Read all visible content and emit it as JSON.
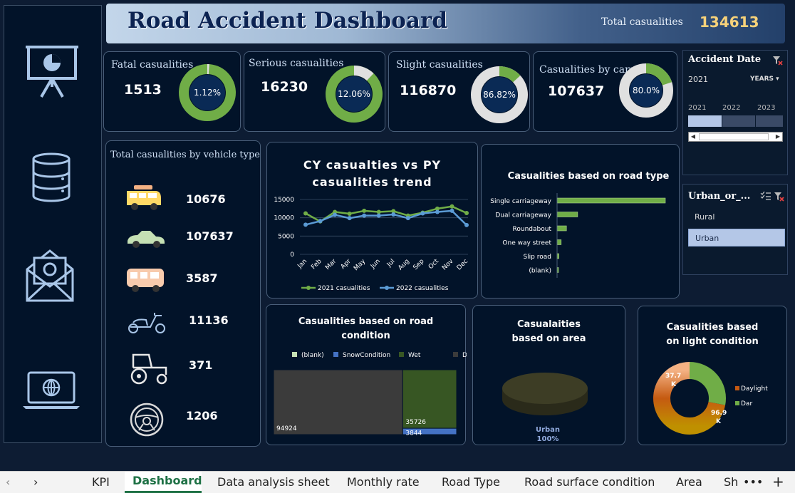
{
  "header": {
    "title": "Road Accident Dashboard",
    "total_label": "Total casualities",
    "total_value": "134613"
  },
  "kpis": [
    {
      "label": "Fatal casualities",
      "value": "1513",
      "pct": "1.12%",
      "fraction": 0.0112
    },
    {
      "label": "Serious casualities",
      "value": "16230",
      "pct": "12.06%",
      "fraction": 0.1206
    },
    {
      "label": "Slight casualities",
      "value": "116870",
      "pct": "86.82%",
      "fraction": 0.8682
    },
    {
      "label": "Casualities by cars",
      "value": "107637",
      "pct": "80.0%",
      "fraction": 0.8
    }
  ],
  "vehicle": {
    "title": "Total casualities by vehicle type",
    "items": [
      {
        "icon": "van-icon",
        "value": "10676"
      },
      {
        "icon": "car-icon",
        "value": "107637"
      },
      {
        "icon": "bus-icon",
        "value": "3587"
      },
      {
        "icon": "scooter-icon",
        "value": "11136"
      },
      {
        "icon": "tractor-icon",
        "value": "371"
      },
      {
        "icon": "steering-wheel-icon",
        "value": "1206"
      }
    ]
  },
  "colors": {
    "green": "#70ad47",
    "blue": "#5b9bd5",
    "gold": "#f7d27a"
  },
  "chart_data": [
    {
      "type": "line",
      "title": "CY casualties vs PY casualities trend",
      "categories": [
        "Jan",
        "Feb",
        "Mar",
        "Apr",
        "May",
        "Jun",
        "Jul",
        "Aug",
        "Sep",
        "Oct",
        "Nov",
        "Dec"
      ],
      "series": [
        {
          "name": "2021 casualities",
          "values": [
            11200,
            9000,
            11600,
            11100,
            11900,
            11600,
            11800,
            10600,
            11400,
            12500,
            13100,
            11300
          ]
        },
        {
          "name": "2022 casualities",
          "values": [
            8100,
            9100,
            10800,
            9900,
            10600,
            10600,
            10900,
            9900,
            11200,
            11600,
            11900,
            8000
          ]
        }
      ],
      "ylim": [
        0,
        15000
      ],
      "yticks": [
        "15000",
        "10000",
        "5000",
        "0"
      ],
      "grid": true,
      "legend": "bottom"
    },
    {
      "type": "bar",
      "title": "Casualities based on road type",
      "categories": [
        "Single carriageway",
        "Dual carriageway",
        "Roundabout",
        "One way street",
        "Slip road",
        "(blank)"
      ],
      "values": [
        100000,
        19000,
        8700,
        3800,
        1700,
        1200
      ]
    },
    {
      "type": "treemap",
      "title": "Casualities based on road condition",
      "legend": [
        "(blank)",
        "SnowCondition",
        "Wet",
        "Dry"
      ],
      "legend_colors": [
        "#c5e0b4",
        "#4472c4",
        "#375623",
        "#3b3b3b"
      ],
      "values": [
        {
          "name": "Dry",
          "value": 94924
        },
        {
          "name": "Wet",
          "value": 35726
        },
        {
          "name": "SnowCondition",
          "value": 3844
        }
      ],
      "labels": [
        "94924",
        "35726",
        "3844"
      ]
    },
    {
      "type": "pie",
      "title": "Casualaities based on area",
      "labels": [
        "Urban"
      ],
      "values": [
        100
      ],
      "data_label": "100%"
    },
    {
      "type": "pie",
      "title": "Casualities based on light condition",
      "labels": [
        "Daylight",
        "Dar"
      ],
      "values": [
        96.9,
        37.7
      ],
      "data_labels": [
        "96.9 K",
        "37.7 K"
      ]
    }
  ],
  "date_slicer": {
    "title": "Accident Date",
    "selected": "2021",
    "level": "YEARS",
    "years": [
      "2021",
      "2022",
      "2023"
    ]
  },
  "urban_slicer": {
    "title": "Urban_or_...",
    "items": [
      "Rural",
      "Urban"
    ]
  },
  "tabs": [
    "KPI",
    "Dashboard",
    "Data analysis sheet",
    "Monthly rate",
    "Road Type",
    "Road surface condition",
    "Area",
    "Sh"
  ]
}
